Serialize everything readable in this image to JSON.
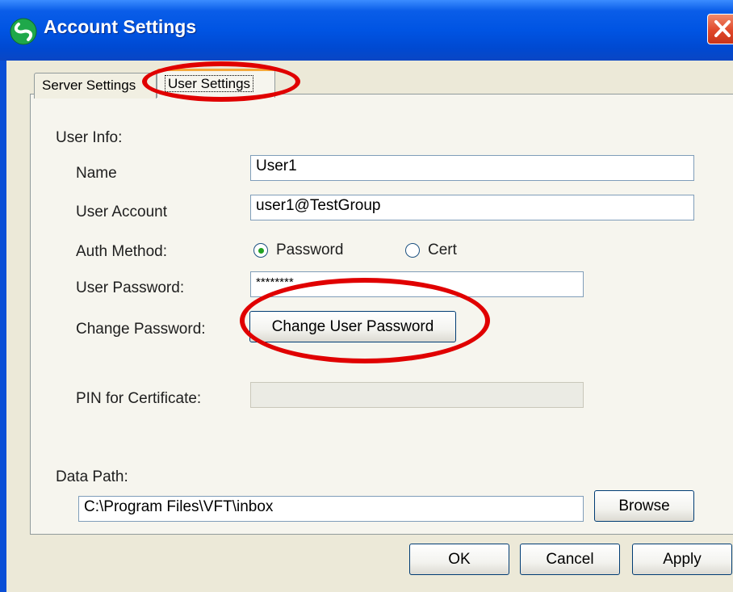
{
  "window": {
    "title": "Account Settings"
  },
  "tabs": [
    {
      "label": "Server Settings",
      "active": false
    },
    {
      "label": "User Settings",
      "active": true
    }
  ],
  "user_info": {
    "section_label": "User Info:",
    "name_label": "Name",
    "name_value": "User1",
    "account_label": "User Account",
    "account_value": "user1@TestGroup",
    "auth_label": "Auth Method:",
    "auth_options": [
      {
        "label": "Password",
        "selected": true
      },
      {
        "label": "Cert",
        "selected": false
      }
    ],
    "password_label": "User Password:",
    "password_value": "********",
    "change_password_label": "Change Password:",
    "change_password_button": "Change User Password",
    "pin_label": "PIN for Certificate:",
    "pin_value": ""
  },
  "data_path": {
    "label": "Data Path:",
    "value": "C:\\Program Files\\VFT\\inbox",
    "browse_button": "Browse"
  },
  "footer": {
    "ok": "OK",
    "cancel": "Cancel",
    "apply": "Apply"
  },
  "colors": {
    "highlight_oval": "#e00000",
    "titlebar": "#0054e3",
    "dialog_bg": "#ece9d8"
  },
  "icons": {
    "app": "green-swirl-icon",
    "close": "close-icon"
  }
}
